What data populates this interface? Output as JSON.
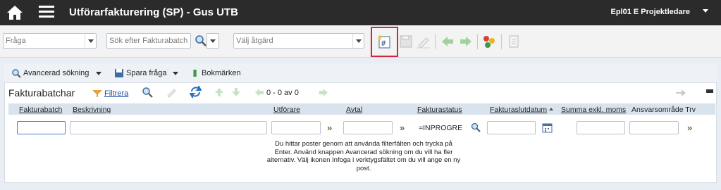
{
  "header": {
    "title": "Utförarfakturering (SP) - Gus UTB",
    "user": "Epl01 E Projektledare"
  },
  "toolbar": {
    "query_placeholder": "Fråga",
    "search_placeholder": "Sök efter Fakturabatch",
    "action_placeholder": "Välj åtgärd"
  },
  "actions": {
    "advanced_search": "Avancerad sökning",
    "save_query": "Spara fråga",
    "bookmarks": "Bokmärken"
  },
  "list": {
    "title": "Fakturabatchar",
    "filter": "Filtrera",
    "pager": "0 - 0 av 0"
  },
  "columns": {
    "batch": "Fakturabatch",
    "desc": "Beskrivning",
    "performer": "Utförare",
    "contract": "Avtal",
    "status": "Fakturastatus",
    "enddate": "Fakturaslutdatum",
    "sum": "Summa exkl. moms",
    "resp": "Ansvarsområde Trv"
  },
  "filters": {
    "status_value": "=INPROGRESS"
  },
  "empty_message": "Du hittar poster genom att använda filterfälten och trycka på Enter. Använd knappen Avancerad sökning om du vill ha fler alternativ. Välj ikonen Infoga i verktygsfältet om du vill ange en ny post.",
  "colors": {
    "topbar": "#2b2b2b",
    "highlight": "#d4263b",
    "link": "#1a4fa0"
  }
}
